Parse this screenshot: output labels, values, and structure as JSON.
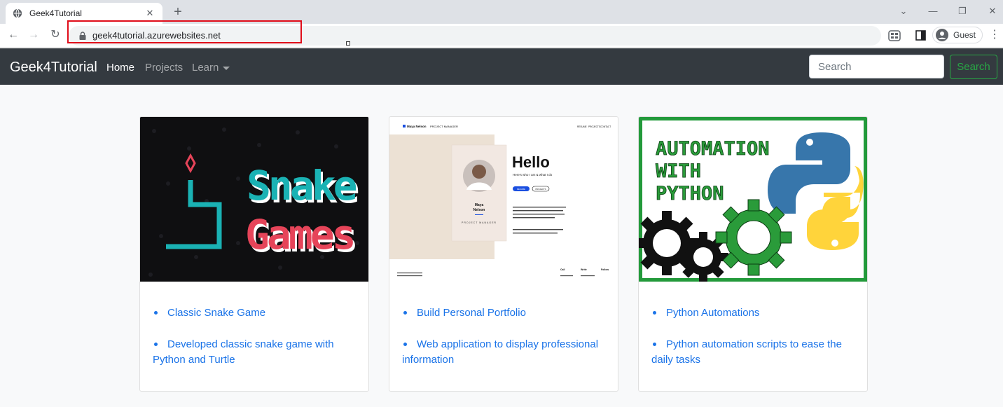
{
  "browser": {
    "tab_title": "Geek4Tutorial",
    "url": "geek4tutorial.azurewebsites.net",
    "profile_label": "Guest",
    "new_tab_glyph": "+",
    "close_tab_glyph": "✕",
    "window_controls": [
      "⌄",
      "—",
      "❐",
      "✕"
    ],
    "nav_glyphs": {
      "back": "←",
      "forward": "→",
      "reload": "↻",
      "menu": "⋮"
    },
    "highlight_color": "#e00d1a"
  },
  "navbar": {
    "brand": "Geek4Tutorial",
    "links": [
      "Home",
      "Projects",
      "Learn"
    ],
    "search_placeholder": "Search",
    "search_button": "Search",
    "accent_color": "#28a745",
    "bg_color": "#343a40"
  },
  "cards": [
    {
      "image_text": [
        "Snake",
        "Games"
      ],
      "items": [
        "Classic Snake Game",
        "Developed classic snake game with Python and Turtle"
      ]
    },
    {
      "image_text": {
        "brand": "Maya Nelson",
        "role": "PROJECT MANAGER",
        "nav": [
          "RESUME",
          "PROJECTS",
          "CONTACT"
        ],
        "hello": "Hello",
        "tagline": "Here's who I am & what I do",
        "buttons": [
          "RESUME",
          "PROJECTS"
        ],
        "card_name": [
          "Maya",
          "Nelson"
        ],
        "card_role": "PROJECT MANAGER",
        "footer": [
          "Call",
          "Write",
          "Follow"
        ]
      },
      "items": [
        "Build Personal Portfolio",
        "Web application to display professional information"
      ]
    },
    {
      "image_text": [
        "AUTOMATION",
        "WITH",
        "PYTHON"
      ],
      "items": [
        "Python Automations",
        "Python automation scripts to ease the daily tasks"
      ]
    }
  ]
}
